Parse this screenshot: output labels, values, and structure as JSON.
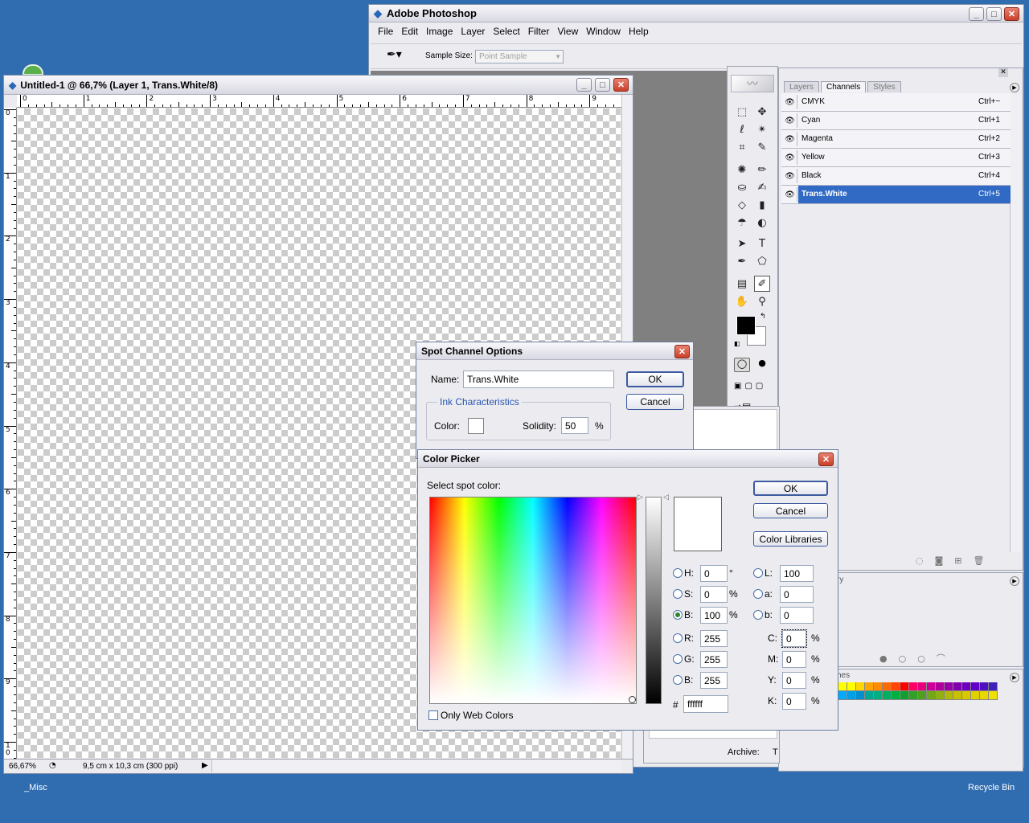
{
  "photoshop": {
    "title": "Adobe Photoshop",
    "menu": [
      "File",
      "Edit",
      "Image",
      "Layer",
      "Select",
      "Filter",
      "View",
      "Window",
      "Help"
    ],
    "options": {
      "sample_size_label": "Sample Size:",
      "sample_size_value": "Point Sample"
    }
  },
  "document": {
    "title": "Untitled-1 @ 66,7% (Layer 1, Trans.White/8)",
    "zoom": "66,67%",
    "status": "9,5 cm x 10,3 cm (300 ppi)",
    "ruler_h": [
      "0",
      "1",
      "2",
      "3",
      "4",
      "5",
      "6",
      "7",
      "8",
      "9"
    ],
    "ruler_v": [
      "0",
      "1",
      "2",
      "3",
      "4",
      "5",
      "6",
      "7",
      "8",
      "9",
      "1\n0"
    ]
  },
  "channels_panel": {
    "tabs": [
      "Layers",
      "Channels",
      "Styles"
    ],
    "rows": [
      {
        "name": "CMYK",
        "shortcut": "Ctrl+~"
      },
      {
        "name": "Cyan",
        "shortcut": "Ctrl+1"
      },
      {
        "name": "Magenta",
        "shortcut": "Ctrl+2"
      },
      {
        "name": "Yellow",
        "shortcut": "Ctrl+3"
      },
      {
        "name": "Black",
        "shortcut": "Ctrl+4"
      },
      {
        "name": "Trans.White",
        "shortcut": "Ctrl+5"
      }
    ],
    "selected_color": "#316ac5"
  },
  "history_panel": {
    "tab_fragment": "ry"
  },
  "swatches_panel": {
    "tab_fragment": "hes",
    "row1": [
      "#ffff00",
      "#ffff00",
      "#ffd700",
      "#ffa500",
      "#ff8c00",
      "#ff6a00",
      "#ff4500",
      "#ff0000",
      "#ff0066",
      "#e6007e",
      "#cc0099",
      "#b0009a",
      "#9900aa",
      "#8000b0",
      "#7000c0",
      "#6000c8",
      "#5010c0",
      "#4020b8"
    ],
    "row2": [
      "#00aaff",
      "#00a0e8",
      "#0090d0",
      "#00a896",
      "#00b080",
      "#00b060",
      "#00b040",
      "#10a030",
      "#30a028",
      "#50a020",
      "#70a818",
      "#90b010",
      "#b0b808",
      "#c8c000",
      "#d8c800",
      "#e0d000",
      "#e8d800",
      "#f0e000"
    ]
  },
  "archive_label": "Archive:",
  "archive_fragment": "T",
  "spot_channel": {
    "title": "Spot Channel Options",
    "name_label": "Name:",
    "name_value": "Trans.White",
    "ok": "OK",
    "cancel": "Cancel",
    "group_label": "Ink Characteristics",
    "color_label": "Color:",
    "solidity_label": "Solidity:",
    "solidity_value": "50",
    "percent": "%"
  },
  "color_picker": {
    "title": "Color Picker",
    "prompt": "Select spot color:",
    "ok": "OK",
    "cancel": "Cancel",
    "libraries": "Color Libraries",
    "only_web": "Only Web Colors",
    "hex_label": "#",
    "hex_value": "ffffff",
    "hsb": [
      {
        "label": "H:",
        "value": "0",
        "unit": "°",
        "checked": false
      },
      {
        "label": "S:",
        "value": "0",
        "unit": "%",
        "checked": false
      },
      {
        "label": "B:",
        "value": "100",
        "unit": "%",
        "checked": true
      }
    ],
    "rgb": [
      {
        "label": "R:",
        "value": "255"
      },
      {
        "label": "G:",
        "value": "255"
      },
      {
        "label": "B:",
        "value": "255"
      }
    ],
    "lab": [
      {
        "label": "L:",
        "value": "100"
      },
      {
        "label": "a:",
        "value": "0"
      },
      {
        "label": "b:",
        "value": "0"
      }
    ],
    "cmyk": [
      {
        "label": "C:",
        "value": "0",
        "unit": "%"
      },
      {
        "label": "M:",
        "value": "0",
        "unit": "%"
      },
      {
        "label": "Y:",
        "value": "0",
        "unit": "%"
      },
      {
        "label": "K:",
        "value": "0",
        "unit": "%"
      }
    ]
  },
  "desktop": {
    "misc": "_Misc",
    "recycle": "Recycle Bin"
  }
}
